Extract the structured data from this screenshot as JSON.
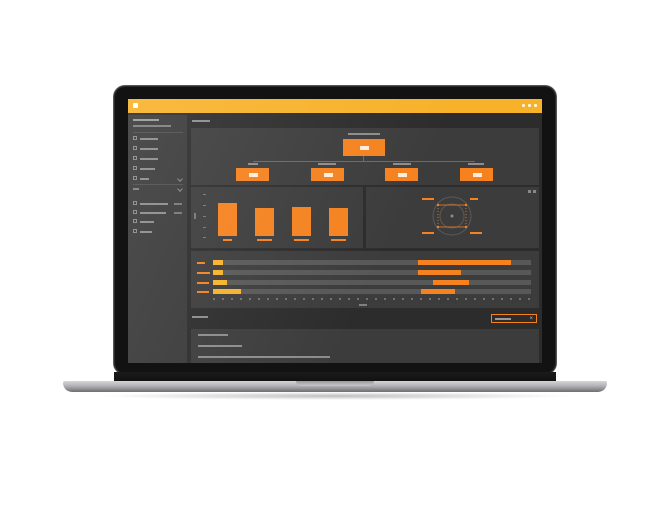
{
  "window": {
    "accent_color": "#f7b22a",
    "highlight_color": "#f5821f",
    "app_icon": "app-icon",
    "window_controls": [
      "dot-icon",
      "dot-icon",
      "dot-icon"
    ]
  },
  "sidebar": {
    "icons": [
      "list-icon",
      "list-icon",
      "list-icon",
      "list-icon",
      "list-icon",
      "grid-icon",
      "grid-icon",
      "grid-icon",
      "grid-icon"
    ]
  },
  "dashboard": {
    "bar_chart_bars": 4,
    "gantt_rows": 4,
    "panel_controls": [
      "expand-icon",
      "more-icon"
    ],
    "search": {
      "close_icon": "close-icon",
      "close_glyph": "×"
    }
  }
}
